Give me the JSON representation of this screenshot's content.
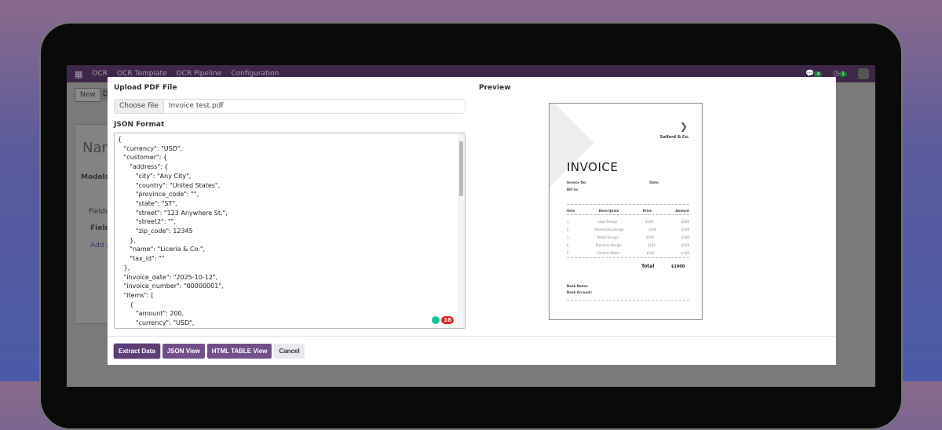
{
  "nav": {
    "app": "OCR",
    "items": [
      "OCR Template",
      "OCR Pipeline",
      "Configuration"
    ],
    "msg_count": "4",
    "activity_count": "1"
  },
  "background": {
    "new_label": "New",
    "d_label": "D",
    "name_label": "Nam",
    "models_label": "Models",
    "fields_label": "Fields",
    "field_label": "Field",
    "add_label": "Add a"
  },
  "modal": {
    "upload_label": "Upload PDF File",
    "choose_file": "Choose file",
    "file_name": "Invoice test.pdf",
    "json_label": "JSON Format",
    "json_text": "{\n   \"currency\": \"USD\",\n   \"customer\": {\n      \"address\": {\n         \"city\": \"Any City\",\n         \"country\": \"United States\",\n         \"province_code\": \"\",\n         \"state\": \"ST\",\n         \"street\": \"123 Anywhere St.\",\n         \"street2\": \"\",\n         \"zip_code\": 12345\n      },\n      \"name\": \"Liceria & Co.\",\n      \"tax_id\": \"\"\n   },\n   \"invoice_date\": \"2025-10-12\",\n   \"invoice_number\": \"00000001\",\n   \"items\": [\n      {\n         \"amount\": 200,\n         \"currency\": \"USD\",",
    "grammarly_count": "16",
    "preview_label": "Preview",
    "buttons": {
      "extract": "Extract Data",
      "json_view": "JSON View",
      "html_table": "HTML TABLE View",
      "cancel": "Cancel"
    }
  },
  "invoice": {
    "company": "Salford & Co.",
    "title": "INVOICE",
    "invoice_no_label": "Invoice No:",
    "date_label": "Date:",
    "bill_to_label": "Bill to:",
    "headers": [
      "Item",
      "Description",
      "Price",
      "Amount"
    ],
    "items": [
      [
        "1.",
        "Logo Design",
        "$100",
        "$100"
      ],
      [
        "2.",
        "Advertising Design",
        "$100",
        "$100"
      ],
      [
        "3.",
        "Poster Design",
        "$100",
        "$100"
      ],
      [
        "4.",
        "Brochure Design",
        "$100",
        "$100"
      ],
      [
        "5.",
        "Content Writer",
        "$100",
        "$100"
      ]
    ],
    "total_label": "Total",
    "total": "$1900",
    "bank_name_label": "Bank Name:",
    "bank_account_label": "Bank Account:"
  }
}
